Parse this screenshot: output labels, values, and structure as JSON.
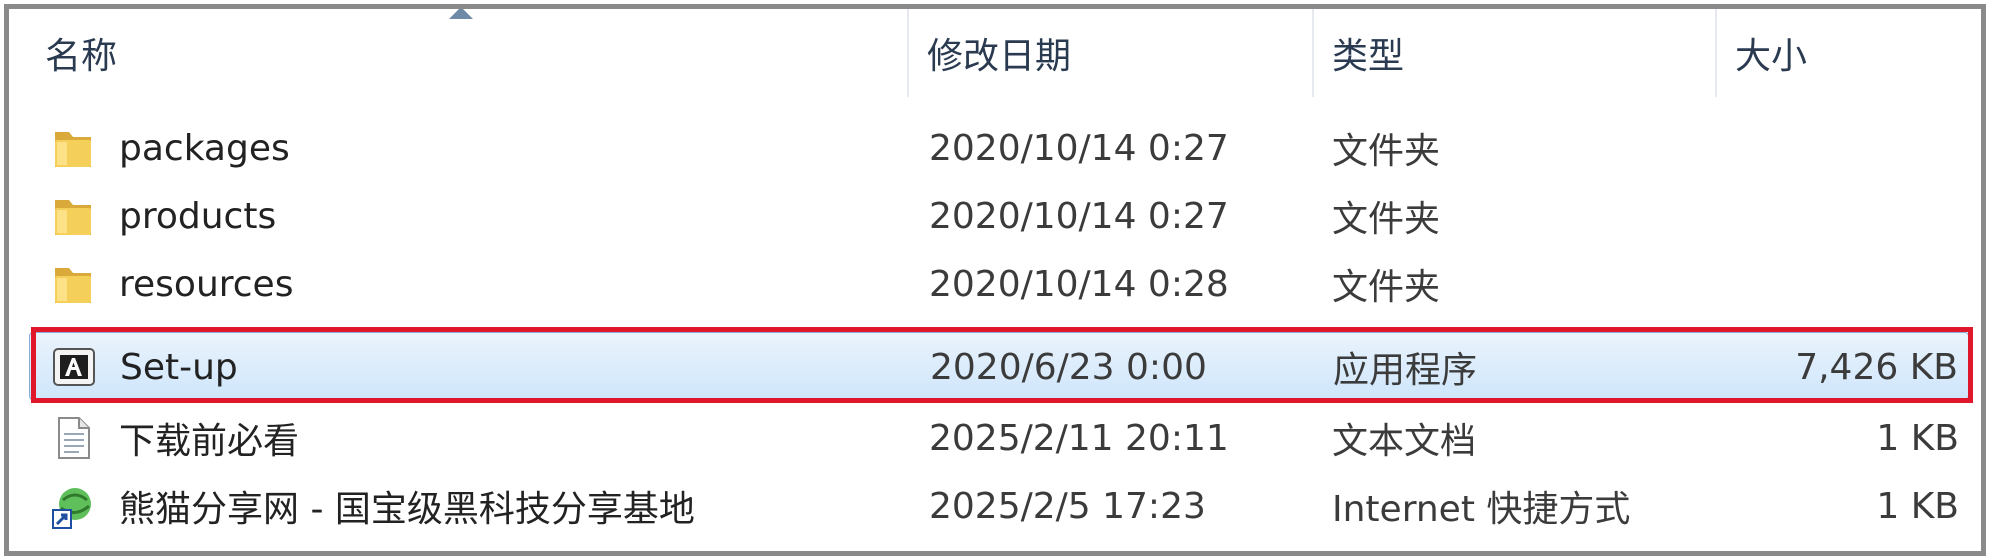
{
  "columns": {
    "name": "名称",
    "date": "修改日期",
    "type": "类型",
    "size": "大小"
  },
  "rows": [
    {
      "name": "packages",
      "date": "2020/10/14 0:27",
      "type": "文件夹",
      "size": "",
      "icon": "folder-icon"
    },
    {
      "name": "products",
      "date": "2020/10/14 0:27",
      "type": "文件夹",
      "size": "",
      "icon": "folder-icon"
    },
    {
      "name": "resources",
      "date": "2020/10/14 0:28",
      "type": "文件夹",
      "size": "",
      "icon": "folder-icon"
    },
    {
      "name": "Set-up",
      "date": "2020/6/23 0:00",
      "type": "应用程序",
      "size": "7,426 KB",
      "icon": "adobe-installer-icon",
      "selected": true
    },
    {
      "name": "下载前必看",
      "date": "2025/2/11 20:11",
      "type": "文本文档",
      "size": "1 KB",
      "icon": "text-file-icon"
    },
    {
      "name": "熊猫分享网 - 国宝级黑科技分享基地",
      "date": "2025/2/5 17:23",
      "type": "Internet 快捷方式",
      "size": "1 KB",
      "icon": "internet-shortcut-icon"
    }
  ],
  "colors": {
    "selection_border": "#84acdd",
    "highlight": "#e0162a",
    "folder": "#f2c94c"
  }
}
